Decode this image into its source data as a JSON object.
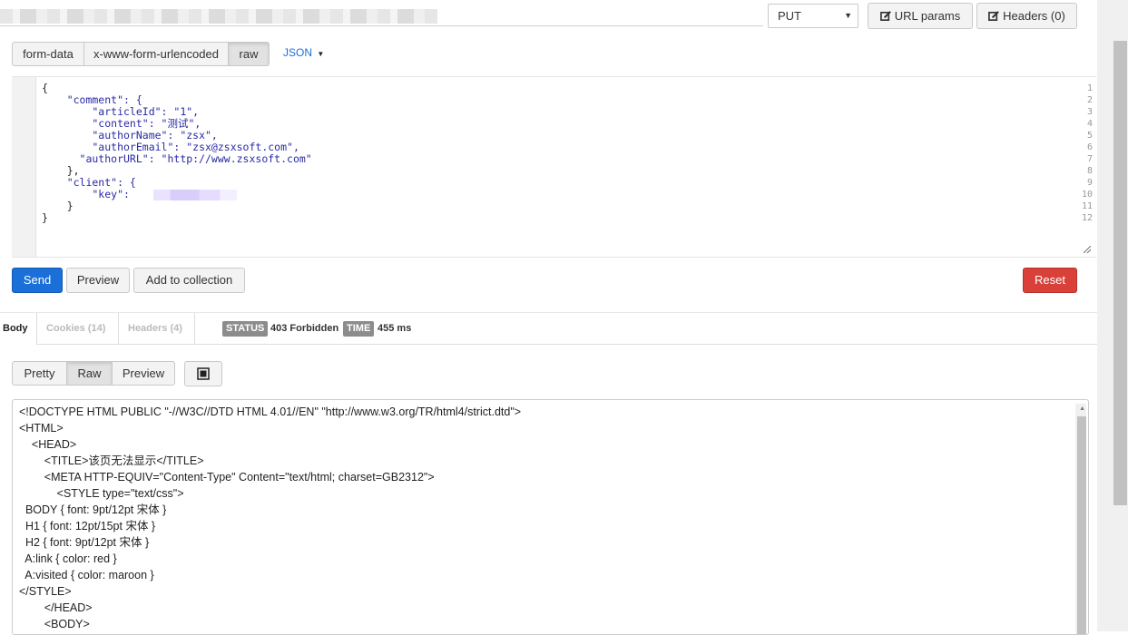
{
  "request": {
    "method": "PUT",
    "url_params_label": "URL params",
    "headers_label": "Headers (0)"
  },
  "body_tabs": {
    "form_data": "form-data",
    "urlencoded": "x-www-form-urlencoded",
    "raw": "raw",
    "format": "JSON"
  },
  "editor": {
    "line_numbers": [
      "1",
      "2",
      "3",
      "4",
      "5",
      "6",
      "7",
      "8",
      "9",
      "10",
      "11",
      "12"
    ],
    "lines": [
      "{",
      "    \"comment\": {",
      "        \"articleId\": \"1\",",
      "        \"content\": \"测试\",",
      "        \"authorName\": \"zsx\",",
      "        \"authorEmail\": \"zsx@zsxsoft.com\",",
      "      \"authorURL\": \"http://www.zsxsoft.com\"",
      "    },",
      "    \"client\": {",
      "        \"key\": ",
      "    }",
      "}"
    ]
  },
  "actions": {
    "send": "Send",
    "preview": "Preview",
    "add_to_collection": "Add to collection",
    "reset": "Reset"
  },
  "response": {
    "tabs": {
      "body": "Body",
      "cookies": "Cookies (14)",
      "headers": "Headers (4)"
    },
    "status_tag": "STATUS",
    "status_value": "403 Forbidden",
    "time_tag": "TIME",
    "time_value": "455 ms",
    "view_tabs": {
      "pretty": "Pretty",
      "raw": "Raw",
      "preview": "Preview"
    },
    "lines": [
      "<!DOCTYPE HTML PUBLIC \"-//W3C//DTD HTML 4.01//EN\" \"http://www.w3.org/TR/html4/strict.dtd\">",
      "<HTML>",
      "    <HEAD>",
      "        <TITLE>该页无法显示</TITLE>",
      "        <META HTTP-EQUIV=\"Content-Type\" Content=\"text/html; charset=GB2312\">",
      "            <STYLE type=\"text/css\">",
      "  BODY { font: 9pt/12pt 宋体 }",
      "  H1 { font: 12pt/15pt 宋体 }",
      "  H2 { font: 9pt/12pt 宋体 }",
      "  A:link { color: red }",
      "  A:visited { color: maroon }",
      "</STYLE>",
      "        </HEAD>",
      "        <BODY>"
    ]
  }
}
